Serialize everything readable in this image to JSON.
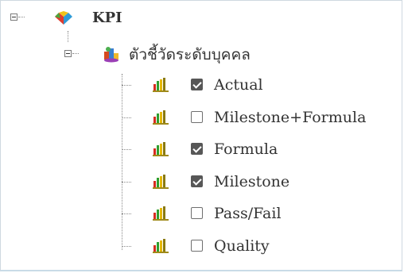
{
  "tree": {
    "root": {
      "label": "KPI",
      "icon": "kpi-icon",
      "expanded": true
    },
    "group": {
      "label": "ตัวชี้วัดระดับบุคคล",
      "icon": "group-icon",
      "expanded": true
    },
    "items": [
      {
        "label": "Actual",
        "checked": true,
        "icon": "bar-chart-icon"
      },
      {
        "label": "Milestone+Formula",
        "checked": false,
        "icon": "bar-chart-icon"
      },
      {
        "label": "Formula",
        "checked": true,
        "icon": "bar-chart-icon"
      },
      {
        "label": "Milestone",
        "checked": true,
        "icon": "bar-chart-icon"
      },
      {
        "label": "Pass/Fail",
        "checked": false,
        "icon": "bar-chart-icon"
      },
      {
        "label": "Quality",
        "checked": false,
        "icon": "bar-chart-icon"
      }
    ]
  },
  "colors": {
    "checked": "#575757",
    "bar_red": "#d62b1f",
    "bar_green": "#2e9e2e",
    "bar_yellow": "#e6b800",
    "bar_olive": "#8a7a10"
  }
}
